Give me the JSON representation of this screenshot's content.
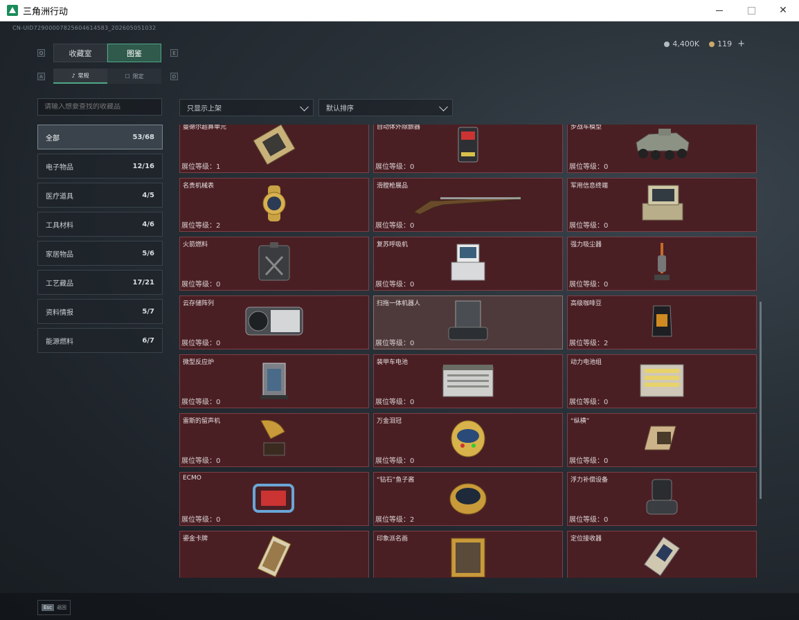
{
  "window": {
    "title": "三角洲行动"
  },
  "uid": "CN-UID72900007825604614583_202605051032",
  "currency": {
    "coins": "4,400K",
    "tickets": "119",
    "plus": "+"
  },
  "tabs": [
    {
      "label": "收藏室",
      "active": false,
      "key": "Q"
    },
    {
      "label": "图鉴",
      "active": true,
      "key": "E"
    }
  ],
  "subtabs": [
    {
      "label": "常规",
      "active": true,
      "key": "A"
    },
    {
      "label": "限定",
      "active": false,
      "key": "D"
    }
  ],
  "search": {
    "placeholder": "请输入想要查找的收藏品"
  },
  "categories": [
    {
      "label": "全部",
      "count": "53/68",
      "active": true
    },
    {
      "label": "电子物品",
      "count": "12/16"
    },
    {
      "label": "医疗道具",
      "count": "4/5"
    },
    {
      "label": "工具材料",
      "count": "4/6"
    },
    {
      "label": "家居物品",
      "count": "5/6"
    },
    {
      "label": "工艺藏品",
      "count": "17/21"
    },
    {
      "label": "资料情报",
      "count": "5/7"
    },
    {
      "label": "能源燃料",
      "count": "6/7"
    }
  ],
  "filters": {
    "shelf": "只显示上架",
    "sort": "默认排序"
  },
  "level_label": "展位等级：",
  "items": [
    {
      "name": "曼德尔超算单元",
      "level": "1",
      "icon": "computer-chip-icon"
    },
    {
      "name": "自动体外除颤器",
      "level": "0",
      "icon": "defibrillator-icon"
    },
    {
      "name": "步战车模型",
      "level": "0",
      "icon": "armored-vehicle-icon"
    },
    {
      "name": "名贵机械表",
      "level": "2",
      "icon": "gold-watch-icon"
    },
    {
      "name": "滑膛枪展品",
      "level": "0",
      "icon": "musket-icon"
    },
    {
      "name": "军用信息终端",
      "level": "0",
      "icon": "military-terminal-icon"
    },
    {
      "name": "火箭燃料",
      "level": "0",
      "icon": "fuel-canister-icon"
    },
    {
      "name": "复苏呼吸机",
      "level": "0",
      "icon": "ventilator-icon"
    },
    {
      "name": "强力吸尘器",
      "level": "0",
      "icon": "vacuum-cleaner-icon"
    },
    {
      "name": "云存储阵列",
      "level": "0",
      "icon": "storage-array-icon"
    },
    {
      "name": "扫拖一体机器人",
      "level": "0",
      "icon": "cleaning-robot-icon",
      "hover": true
    },
    {
      "name": "高级咖啡豆",
      "level": "2",
      "icon": "coffee-bag-icon"
    },
    {
      "name": "微型反应炉",
      "level": "0",
      "icon": "reactor-icon"
    },
    {
      "name": "装甲车电池",
      "level": "0",
      "icon": "vehicle-battery-icon"
    },
    {
      "name": "动力电池组",
      "level": "0",
      "icon": "battery-pack-icon"
    },
    {
      "name": "雷斯的留声机",
      "level": "0",
      "icon": "gramophone-icon"
    },
    {
      "name": "万金泪冠",
      "level": "0",
      "icon": "jeweled-egg-icon"
    },
    {
      "name": "“纵横”",
      "level": "0",
      "icon": "chess-board-icon"
    },
    {
      "name": "ECMO",
      "level": "0",
      "icon": "ecmo-machine-icon"
    },
    {
      "name": "“钻石”鱼子酱",
      "level": "2",
      "icon": "caviar-tin-icon"
    },
    {
      "name": "浮力补偿设备",
      "level": "0",
      "icon": "buoyancy-device-icon"
    },
    {
      "name": "鎏金卡牌",
      "level": "",
      "icon": "gilded-card-icon"
    },
    {
      "name": "印象派名画",
      "level": "",
      "icon": "painting-icon"
    },
    {
      "name": "定位接收器",
      "level": "",
      "icon": "gps-receiver-icon"
    }
  ],
  "footer": {
    "esc_key": "Esc",
    "back_label": "返回"
  }
}
